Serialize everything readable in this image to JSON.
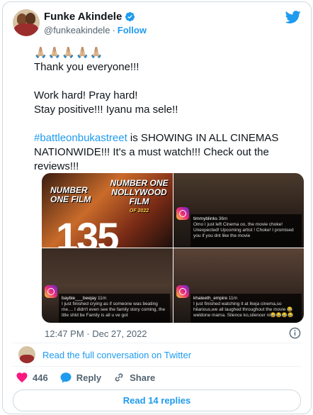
{
  "author": {
    "name": "Funke Akindele",
    "handle": "@funkeakindele",
    "separator": "·",
    "follow_label": "Follow"
  },
  "tweet": {
    "emojis": "🙏🏼🙏🏼🙏🏼🙏🏼🙏🏼",
    "line1": "Thank you everyone!!!",
    "line2": "Work hard! Pray hard!\nStay positive!!! Iyanu ma sele!!",
    "hashtag": "#battleonbukastreet",
    "line3_rest": " is SHOWING IN ALL CINEMAS NATIONWIDE!!! It's a must watch!!! Check out the reviews!!!"
  },
  "media": {
    "tile1": {
      "text_left": "NUMBER\nONE FILM",
      "text_right": "NUMBER ONE\nNOLLYWOOD FILM",
      "sub": "OF 2022",
      "big": "135"
    },
    "tile2": {
      "user": "timmyblinks",
      "time": "36m",
      "comment": "Omo I just left Cinema oo, the movie choke! Unexpected! Upcoming artist ! Choke! I promised you if you dnt like the movie"
    },
    "tile3": {
      "user": "baybie___beejay",
      "time": "11m",
      "comment": "I just finished crying as if someone was beating me.... I didn't even see the family story coming, the title shld be Family is all u ve got"
    },
    "tile4": {
      "user": "khaleeth_empire",
      "time": "11m",
      "comment": "I just finished watching it at Ikeja cinema,so hilarious,we all laughed throughout the movie 😂 weldone mama. Silence ko,silencer ni😂😂😂😂"
    }
  },
  "timestamp": "12:47 PM · Dec 27, 2022",
  "read_conversation": "Read the full conversation on Twitter",
  "actions": {
    "likes": "446",
    "reply_label": "Reply",
    "share_label": "Share"
  },
  "read_replies": "Read 14 replies",
  "colors": {
    "accent": "#1d9bf0",
    "like": "#f91880",
    "text": "#0f1419",
    "muted": "#536471"
  }
}
